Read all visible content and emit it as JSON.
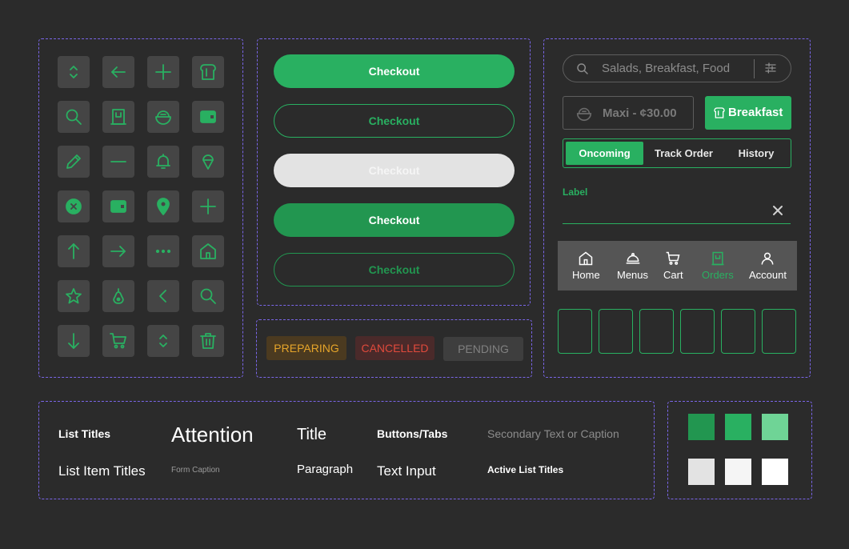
{
  "icons": [
    "chevrons-updown-icon",
    "arrow-left-icon",
    "plus-icon",
    "toast-icon",
    "search-icon",
    "menu-book-icon",
    "bowl-icon",
    "wallet-icon",
    "pencil-icon",
    "minus-icon",
    "bell-icon",
    "ice-cream-icon",
    "close-circle-icon",
    "wallet-icon",
    "location-pin-icon",
    "plus-icon",
    "arrow-up-icon",
    "arrow-right-icon",
    "more-horizontal-icon",
    "home-icon",
    "star-icon",
    "pear-icon",
    "chevron-left-icon",
    "search-icon",
    "arrow-down-icon",
    "cart-icon",
    "chevrons-updown-icon",
    "trash-icon"
  ],
  "buttons": {
    "primary": "Checkout",
    "outline": "Checkout",
    "disabled": "Checkout",
    "pressed": "Checkout",
    "outline_pressed": "Checkout"
  },
  "status_badges": {
    "preparing": "PREPARING",
    "cancelled": "CANCELLED",
    "pending": "PENDING"
  },
  "search": {
    "placeholder": "Salads, Breakfast, Food"
  },
  "chips": {
    "maxi": "Maxi - ¢30.00",
    "breakfast": "Breakfast"
  },
  "tabs": [
    "Oncoming",
    "Track Order",
    "History"
  ],
  "text_field": {
    "label": "Label"
  },
  "bottom_nav": [
    "Home",
    "Menus",
    "Cart",
    "Orders",
    "Account"
  ],
  "typography": {
    "list_titles": "List Titles",
    "list_item_titles": "List Item Titles",
    "attention": "Attention",
    "form_caption": "Form Caption",
    "title": "Title",
    "paragraph": "Paragraph",
    "buttons_tabs": "Buttons/Tabs",
    "text_input": "Text Input",
    "secondary": "Secondary Text or Caption",
    "active_list_titles": "Active List Titles"
  },
  "colors": {
    "accent": "#29b061",
    "accent_dark": "#229650",
    "swatches": [
      "#229650",
      "#29b061",
      "#6fd496",
      "#e3e3e3",
      "#f5f5f5",
      "#ffffff"
    ]
  }
}
